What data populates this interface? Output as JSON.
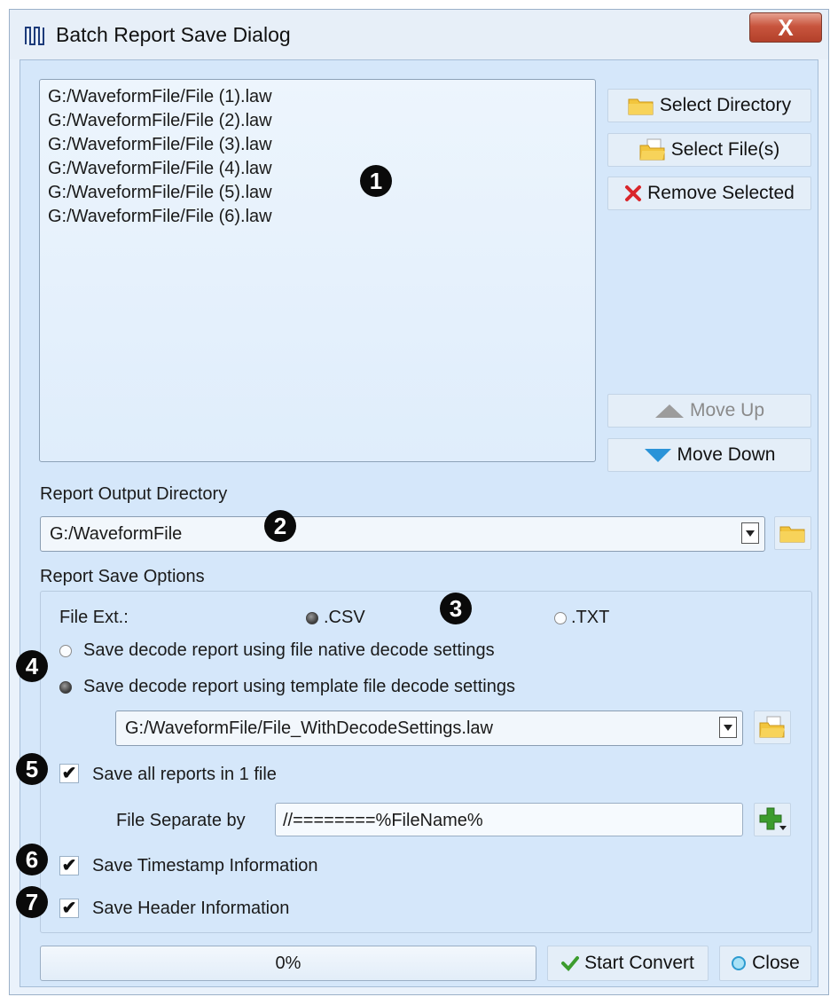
{
  "window": {
    "title": "Batch Report Save Dialog",
    "close_label": "X"
  },
  "file_list": [
    "G:/WaveformFile/File (1).law",
    "G:/WaveformFile/File (2).law",
    "G:/WaveformFile/File (3).law",
    "G:/WaveformFile/File (4).law",
    "G:/WaveformFile/File (5).law",
    "G:/WaveformFile/File (6).law"
  ],
  "buttons": {
    "select_directory": "Select Directory",
    "select_files": "Select File(s)",
    "remove_selected": "Remove Selected",
    "move_up": "Move Up",
    "move_down": "Move Down",
    "start_convert": "Start Convert",
    "close": "Close"
  },
  "output": {
    "label": "Report Output Directory",
    "directory": "G:/WaveformFile"
  },
  "options": {
    "group_label": "Report Save Options",
    "file_ext_label": "File Ext.:",
    "ext_csv": ".CSV",
    "ext_txt": ".TXT",
    "selected_ext": ".CSV",
    "native_label": "Save decode report using file native decode settings",
    "template_label": "Save decode report using template file decode settings",
    "template_file": "G:/WaveformFile/File_WithDecodeSettings.law",
    "save_all_label": "Save all reports in 1 file",
    "save_all_checked": true,
    "separate_label": "File Separate by",
    "separator_value": "//========%FileName%",
    "timestamp_label": "Save Timestamp Information",
    "timestamp_checked": true,
    "header_label": "Save Header Information",
    "header_checked": true
  },
  "progress": {
    "value": 0,
    "text": "0%"
  },
  "callouts": [
    "1",
    "2",
    "3",
    "4",
    "5",
    "6",
    "7"
  ],
  "colors": {
    "client_bg": "#d5e7fa",
    "close_red": "#c8553e",
    "folder_yellow": "#f2c53d",
    "move_down_blue": "#2a93d8",
    "remove_red": "#d9262b",
    "plus_green": "#3c9c2e"
  },
  "icons": [
    "app-waveform-icon",
    "folder-icon",
    "open-folder-icon",
    "remove-x-icon",
    "up-triangle-icon",
    "down-triangle-icon",
    "checkmark-icon",
    "circle-icon",
    "plus-icon"
  ]
}
